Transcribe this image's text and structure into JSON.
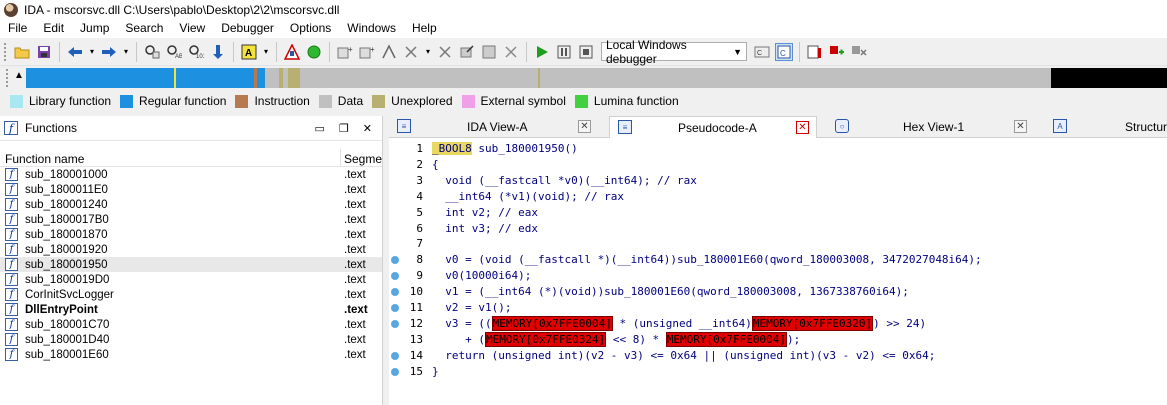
{
  "window": {
    "title": "IDA - mscorsvc.dll C:\\Users\\pablo\\Desktop\\2\\2\\mscorsvc.dll"
  },
  "menu": [
    "File",
    "Edit",
    "Jump",
    "Search",
    "View",
    "Debugger",
    "Options",
    "Windows",
    "Help"
  ],
  "toolbar": {
    "debugger_select": "Local Windows debugger",
    "icons": [
      "open-icon",
      "save-icon",
      "back-icon",
      "forward-icon",
      "hex-search-icon",
      "text-search-icon",
      "binary-search-icon",
      "jump-icon",
      "assemble-icon",
      "graph-icon",
      "run-icon",
      "pause-icon",
      "stop-icon"
    ]
  },
  "legend": [
    {
      "label": "Library function",
      "color": "#a8e8f0"
    },
    {
      "label": "Regular function",
      "color": "#1e90e0"
    },
    {
      "label": "Instruction",
      "color": "#b87850"
    },
    {
      "label": "Data",
      "color": "#c0c0c0"
    },
    {
      "label": "Unexplored",
      "color": "#b8b070"
    },
    {
      "label": "External symbol",
      "color": "#f0a0e8"
    },
    {
      "label": "Lumina function",
      "color": "#40d040"
    }
  ],
  "functions_panel": {
    "title": "Functions",
    "col_name": "Function name",
    "col_segment": "Segme",
    "rows": [
      {
        "name": "sub_180001000",
        "segment": ".text",
        "selected": false,
        "bold": false
      },
      {
        "name": "sub_1800011E0",
        "segment": ".text",
        "selected": false,
        "bold": false
      },
      {
        "name": "sub_180001240",
        "segment": ".text",
        "selected": false,
        "bold": false
      },
      {
        "name": "sub_1800017B0",
        "segment": ".text",
        "selected": false,
        "bold": false
      },
      {
        "name": "sub_180001870",
        "segment": ".text",
        "selected": false,
        "bold": false
      },
      {
        "name": "sub_180001920",
        "segment": ".text",
        "selected": false,
        "bold": false
      },
      {
        "name": "sub_180001950",
        "segment": ".text",
        "selected": true,
        "bold": false
      },
      {
        "name": "sub_1800019D0",
        "segment": ".text",
        "selected": false,
        "bold": false
      },
      {
        "name": "CorInitSvcLogger",
        "segment": ".text",
        "selected": false,
        "bold": false
      },
      {
        "name": "DllEntryPoint",
        "segment": ".text",
        "selected": false,
        "bold": true
      },
      {
        "name": "sub_180001C70",
        "segment": ".text",
        "selected": false,
        "bold": false
      },
      {
        "name": "sub_180001D40",
        "segment": ".text",
        "selected": false,
        "bold": false
      },
      {
        "name": "sub_180001E60",
        "segment": ".text",
        "selected": false,
        "bold": false
      }
    ]
  },
  "tabs": [
    {
      "label": "IDA View-A",
      "active": false,
      "icon": "ida-view-icon"
    },
    {
      "label": "Pseudocode-A",
      "active": true,
      "icon": "pseudocode-icon"
    },
    {
      "label": "Hex View-1",
      "active": false,
      "icon": "hex-view-icon"
    },
    {
      "label": "Structure",
      "active": false,
      "icon": "structures-icon"
    }
  ],
  "code": {
    "lines": [
      {
        "n": "1",
        "dot": false
      },
      {
        "n": "2",
        "dot": false,
        "text": "{"
      },
      {
        "n": "3",
        "dot": false,
        "text": "  void (__fastcall *v0)(__int64); // rax"
      },
      {
        "n": "4",
        "dot": false,
        "text": "  __int64 (*v1)(void); // rax"
      },
      {
        "n": "5",
        "dot": false,
        "text": "  int v2; // eax"
      },
      {
        "n": "6",
        "dot": false,
        "text": "  int v3; // edx"
      },
      {
        "n": "7",
        "dot": false,
        "text": ""
      },
      {
        "n": "8",
        "dot": true,
        "text": "  v0 = (void (__fastcall *)(__int64))sub_180001E60(qword_180003008, 3472027048i64);"
      },
      {
        "n": "9",
        "dot": true,
        "text": "  v0(10000i64);"
      },
      {
        "n": "10",
        "dot": true,
        "text": "  v1 = (__int64 (*)(void))sub_180001E60(qword_180003008, 1367338760i64);"
      },
      {
        "n": "11",
        "dot": true,
        "text": "  v2 = v1();"
      },
      {
        "n": "12",
        "dot": true
      },
      {
        "n": "13",
        "dot": false
      },
      {
        "n": "14",
        "dot": true,
        "text": "  return (unsigned int)(v2 - v3) <= 0x64 || (unsigned int)(v3 - v2) <= 0x64;"
      },
      {
        "n": "15",
        "dot": true,
        "text": "}"
      }
    ],
    "line1": {
      "type": "_BOOL8",
      "rest": " sub_180001950()"
    },
    "line12": {
      "pre": "  v3 = ((",
      "mem1": "MEMORY[0x7FFE0004]",
      "mid": " * (unsigned __int64)",
      "mem2": "MEMORY[0x7FFE0320]",
      "post": ") >> 24)"
    },
    "line13": {
      "pre": "     + (",
      "mem1": "MEMORY[0x7FFE0324]",
      "mid": " << 8) * ",
      "mem2": "MEMORY[0x7FFE0004]",
      "post": ");"
    }
  }
}
